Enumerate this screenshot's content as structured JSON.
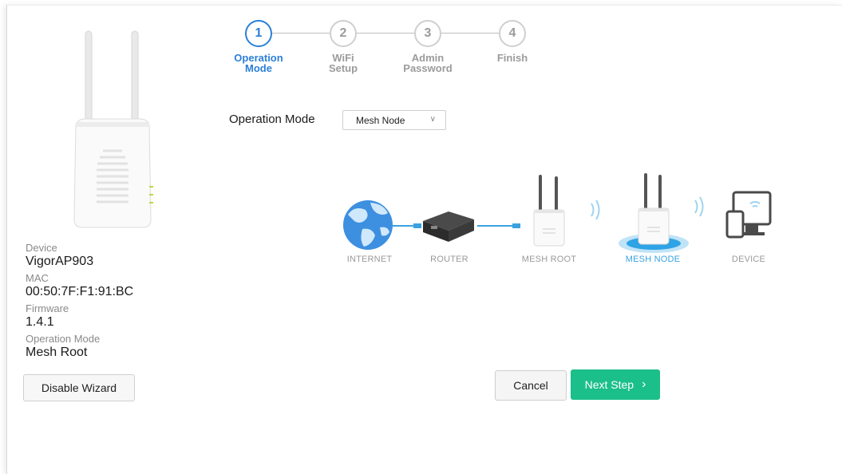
{
  "stepper": {
    "steps": [
      {
        "number": "1",
        "label": "Operation\nMode",
        "active": true
      },
      {
        "number": "2",
        "label": "WiFi\nSetup",
        "active": false
      },
      {
        "number": "3",
        "label": "Admin\nPassword",
        "active": false
      },
      {
        "number": "4",
        "label": "Finish",
        "active": false
      }
    ]
  },
  "device_info": {
    "device_label": "Device",
    "device_value": "VigorAP903",
    "mac_label": "MAC",
    "mac_value": "00:50:7F:F1:91:BC",
    "firmware_label": "Firmware",
    "firmware_value": "1.4.1",
    "opmode_label": "Operation Mode",
    "opmode_value": "Mesh Root"
  },
  "operation_mode": {
    "label": "Operation Mode",
    "selected": "Mesh Node"
  },
  "diagram": {
    "nodes": [
      "INTERNET",
      "ROUTER",
      "MESH ROOT",
      "MESH NODE",
      "DEVICE"
    ],
    "active_node": "MESH NODE"
  },
  "buttons": {
    "disable_wizard": "Disable Wizard",
    "cancel": "Cancel",
    "next_step": "Next Step",
    "next_arrow": "›"
  },
  "colors": {
    "accent_blue": "#2b7fd8",
    "next_green": "#1bbf8a",
    "inactive_gray": "#9b9b9b"
  }
}
